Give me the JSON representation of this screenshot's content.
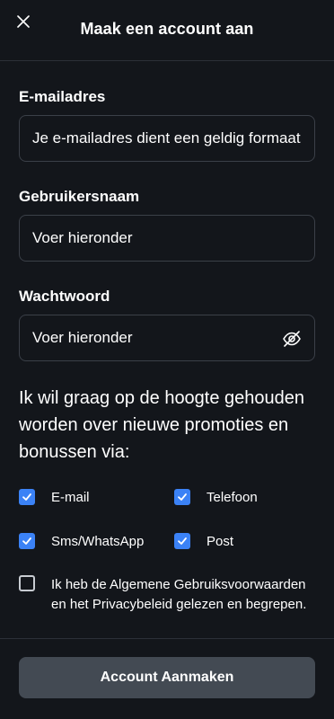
{
  "header": {
    "title": "Maak een account aan",
    "close_icon": "close-icon"
  },
  "form": {
    "email": {
      "label": "E-mailadres",
      "value": "Je e-mailadres dient een geldig formaat te hebben"
    },
    "username": {
      "label": "Gebruikersnaam",
      "placeholder": "Voer hieronder"
    },
    "password": {
      "label": "Wachtwoord",
      "placeholder": "Voer hieronder",
      "toggle_icon": "eye-slash-icon"
    }
  },
  "promotions": {
    "prompt": "Ik wil graag op de hoogte gehouden worden over nieuwe promoties en bonussen via:",
    "options": [
      {
        "label": "E-mail",
        "checked": true
      },
      {
        "label": "Telefoon",
        "checked": true
      },
      {
        "label": "Sms/WhatsApp",
        "checked": true
      },
      {
        "label": "Post",
        "checked": true
      }
    ]
  },
  "terms": {
    "label": "Ik heb de Algemene Gebruiksvoorwaarden en het Privacybeleid gelezen en begrepen.",
    "checked": false
  },
  "submit": {
    "label": "Account Aanmaken"
  },
  "colors": {
    "background": "#13161b",
    "accent": "#3b82f6",
    "button": "#434a53",
    "border": "#3b4048"
  }
}
